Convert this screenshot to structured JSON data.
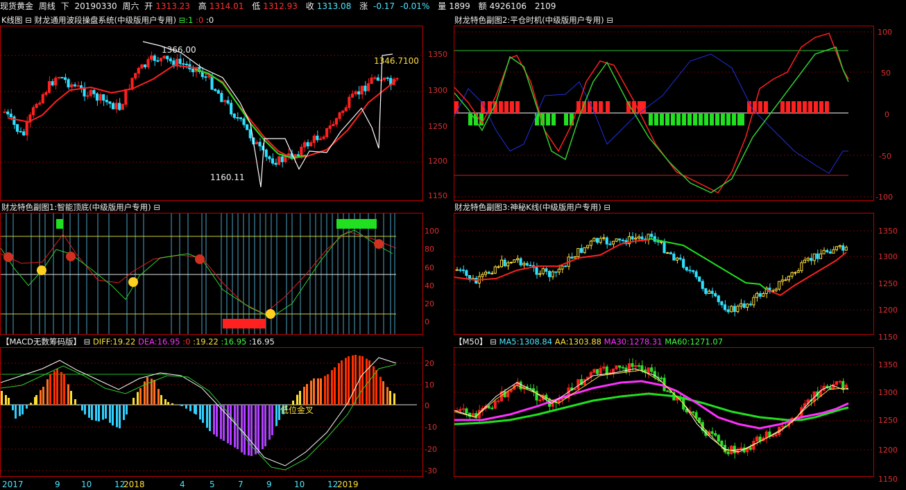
{
  "header": {
    "symbol": "现货黄金",
    "period": "周线",
    "nav": "下",
    "date": "20190330",
    "weekday": "周六",
    "open_label": "开",
    "open": "1313.23",
    "high_label": "高",
    "high": "1314.01",
    "low_label": "低",
    "low": "1312.93",
    "close_label": "收",
    "close": "1313.08",
    "chg_label": "涨",
    "chg": "-0.17",
    "chg_pct": "-0.01%",
    "vol_label": "量",
    "vol": "1899",
    "amt_label": "额",
    "amt": "4926106",
    "oi": "2109"
  },
  "panel_k": {
    "title": "K线图 ⊟ 财龙通用波段操盘系统(中级版用户专用)",
    "params": [
      {
        "text": "⊟:1",
        "color": "#3dff3d"
      },
      {
        "text": ":0",
        "color": "#ff3030"
      },
      {
        "text": ":0",
        "color": "#f0f0f0"
      }
    ],
    "annot_high": "1366.00",
    "annot_low": "1160.11",
    "annot_last": "1346.7100",
    "yticks": [
      "1350",
      "1300",
      "1250",
      "1200",
      "1150"
    ]
  },
  "panel_sub1": {
    "title": "财龙特色副图1:智能顶底(中级版用户专用)  ⊟",
    "yticks": [
      "100",
      "80",
      "60",
      "40",
      "20",
      "0"
    ]
  },
  "panel_macd": {
    "title": "【MACD无数筹码版】 ⊟",
    "items": [
      {
        "text": "DIFF:19.22",
        "color": "#ffe040"
      },
      {
        "text": "DEA:16.95",
        "color": "#ff30ff"
      },
      {
        "text": ":0",
        "color": "#ff3030"
      },
      {
        "text": ":19.22",
        "color": "#ffe040"
      },
      {
        "text": ":16.95",
        "color": "#3dff3d"
      },
      {
        "text": ":16.95",
        "color": "#f0f0f0"
      }
    ],
    "annot": "低位金叉",
    "yticks": [
      "20",
      "10",
      "0",
      "-10",
      "-20",
      "-30"
    ]
  },
  "panel_sub2": {
    "title": "财龙特色副图2:平仓时机(中级版用户专用)  ⊟",
    "yticks": [
      "100",
      "50",
      "0",
      "-50",
      "-100"
    ]
  },
  "panel_sub3": {
    "title": "财龙特色副图3:神秘K线(中级版用户专用)  ⊟",
    "yticks": [
      "1350",
      "1300",
      "1250",
      "1200",
      "1150"
    ]
  },
  "panel_ma": {
    "title": "【M50】 ⊟",
    "items": [
      {
        "text": "MA5:1308.84",
        "color": "#4fe6ff"
      },
      {
        "text": "AA:1303.88",
        "color": "#ffe040"
      },
      {
        "text": "MA30:1278.31",
        "color": "#ff30ff"
      },
      {
        "text": "MA60:1271.07",
        "color": "#3dff3d"
      }
    ],
    "yticks": [
      "1350",
      "1300",
      "1250",
      "1200",
      "1150"
    ]
  },
  "time_axis": [
    {
      "label": "2017",
      "color": "#4fe6ff"
    },
    {
      "label": "9",
      "color": "#4fe6ff"
    },
    {
      "label": "10",
      "color": "#4fe6ff"
    },
    {
      "label": "12",
      "color": "#4fe6ff"
    },
    {
      "label": "2018",
      "color": "#ffe040"
    },
    {
      "label": "4",
      "color": "#4fe6ff"
    },
    {
      "label": "5",
      "color": "#4fe6ff"
    },
    {
      "label": "7",
      "color": "#4fe6ff"
    },
    {
      "label": "9",
      "color": "#4fe6ff"
    },
    {
      "label": "10",
      "color": "#4fe6ff"
    },
    {
      "label": "12",
      "color": "#4fe6ff"
    },
    {
      "label": "2019",
      "color": "#ffe040"
    }
  ]
}
